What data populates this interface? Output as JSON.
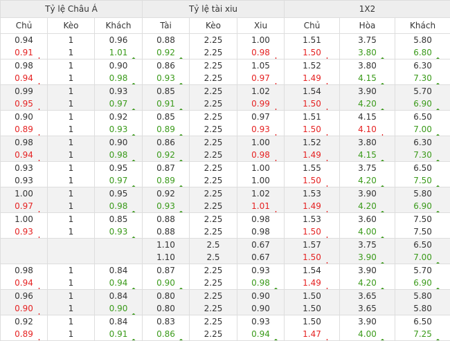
{
  "groups": [
    {
      "label": "Tỷ lệ Châu Á",
      "span": 3
    },
    {
      "label": "Tỷ lệ tài xiu",
      "span": 3
    },
    {
      "label": "1X2",
      "span": 3
    }
  ],
  "columns": [
    "Chủ",
    "Kèo",
    "Khách",
    "Tài",
    "Kèo",
    "Xiu",
    "Chủ",
    "Hòa",
    "Khách"
  ],
  "arrows": {
    "up": "↑",
    "down": "↓"
  },
  "colors": {
    "up": "#3a9a1a",
    "down": "#e52222",
    "neutral": "#333333",
    "header_bg": "#eeeeee",
    "row_alt": "#f2f2f2"
  },
  "rows": [
    {
      "shade": false,
      "cells": [
        [
          {
            "v": "0.94",
            "d": ""
          },
          {
            "v": "0.91",
            "d": "down"
          }
        ],
        [
          {
            "v": "1",
            "d": ""
          },
          {
            "v": "1",
            "d": ""
          }
        ],
        [
          {
            "v": "0.96",
            "d": ""
          },
          {
            "v": "1.01",
            "d": "up"
          }
        ],
        [
          {
            "v": "0.88",
            "d": ""
          },
          {
            "v": "0.92",
            "d": "up"
          }
        ],
        [
          {
            "v": "2.25",
            "d": ""
          },
          {
            "v": "2.25",
            "d": ""
          }
        ],
        [
          {
            "v": "1.00",
            "d": ""
          },
          {
            "v": "0.98",
            "d": "down"
          }
        ],
        [
          {
            "v": "1.51",
            "d": ""
          },
          {
            "v": "1.50",
            "d": "down"
          }
        ],
        [
          {
            "v": "3.75",
            "d": ""
          },
          {
            "v": "3.80",
            "d": "up"
          }
        ],
        [
          {
            "v": "5.80",
            "d": ""
          },
          {
            "v": "6.80",
            "d": "up"
          }
        ]
      ]
    },
    {
      "shade": false,
      "cells": [
        [
          {
            "v": "0.98",
            "d": ""
          },
          {
            "v": "0.94",
            "d": "down"
          }
        ],
        [
          {
            "v": "1",
            "d": ""
          },
          {
            "v": "1",
            "d": ""
          }
        ],
        [
          {
            "v": "0.90",
            "d": ""
          },
          {
            "v": "0.98",
            "d": "up"
          }
        ],
        [
          {
            "v": "0.86",
            "d": ""
          },
          {
            "v": "0.93",
            "d": "up"
          }
        ],
        [
          {
            "v": "2.25",
            "d": ""
          },
          {
            "v": "2.25",
            "d": ""
          }
        ],
        [
          {
            "v": "1.05",
            "d": ""
          },
          {
            "v": "0.97",
            "d": "down"
          }
        ],
        [
          {
            "v": "1.52",
            "d": ""
          },
          {
            "v": "1.49",
            "d": "down"
          }
        ],
        [
          {
            "v": "3.80",
            "d": ""
          },
          {
            "v": "4.15",
            "d": "up"
          }
        ],
        [
          {
            "v": "6.30",
            "d": ""
          },
          {
            "v": "7.30",
            "d": "up"
          }
        ]
      ]
    },
    {
      "shade": true,
      "cells": [
        [
          {
            "v": "0.99",
            "d": ""
          },
          {
            "v": "0.95",
            "d": "down"
          }
        ],
        [
          {
            "v": "1",
            "d": ""
          },
          {
            "v": "1",
            "d": ""
          }
        ],
        [
          {
            "v": "0.93",
            "d": ""
          },
          {
            "v": "0.97",
            "d": "up"
          }
        ],
        [
          {
            "v": "0.85",
            "d": ""
          },
          {
            "v": "0.91",
            "d": "up"
          }
        ],
        [
          {
            "v": "2.25",
            "d": ""
          },
          {
            "v": "2.25",
            "d": ""
          }
        ],
        [
          {
            "v": "1.02",
            "d": ""
          },
          {
            "v": "0.99",
            "d": "down"
          }
        ],
        [
          {
            "v": "1.54",
            "d": ""
          },
          {
            "v": "1.50",
            "d": "down"
          }
        ],
        [
          {
            "v": "3.90",
            "d": ""
          },
          {
            "v": "4.20",
            "d": "up"
          }
        ],
        [
          {
            "v": "5.70",
            "d": ""
          },
          {
            "v": "6.90",
            "d": "up"
          }
        ]
      ]
    },
    {
      "shade": false,
      "cells": [
        [
          {
            "v": "0.90",
            "d": ""
          },
          {
            "v": "0.89",
            "d": "down"
          }
        ],
        [
          {
            "v": "1",
            "d": ""
          },
          {
            "v": "1",
            "d": ""
          }
        ],
        [
          {
            "v": "0.92",
            "d": ""
          },
          {
            "v": "0.93",
            "d": "up"
          }
        ],
        [
          {
            "v": "0.85",
            "d": ""
          },
          {
            "v": "0.89",
            "d": "up"
          }
        ],
        [
          {
            "v": "2.25",
            "d": ""
          },
          {
            "v": "2.25",
            "d": ""
          }
        ],
        [
          {
            "v": "0.97",
            "d": ""
          },
          {
            "v": "0.93",
            "d": "down"
          }
        ],
        [
          {
            "v": "1.51",
            "d": ""
          },
          {
            "v": "1.50",
            "d": "down"
          }
        ],
        [
          {
            "v": "4.15",
            "d": ""
          },
          {
            "v": "4.10",
            "d": "down"
          }
        ],
        [
          {
            "v": "6.50",
            "d": ""
          },
          {
            "v": "7.00",
            "d": "up"
          }
        ]
      ]
    },
    {
      "shade": true,
      "cells": [
        [
          {
            "v": "0.98",
            "d": ""
          },
          {
            "v": "0.94",
            "d": "down"
          }
        ],
        [
          {
            "v": "1",
            "d": ""
          },
          {
            "v": "1",
            "d": ""
          }
        ],
        [
          {
            "v": "0.90",
            "d": ""
          },
          {
            "v": "0.98",
            "d": "up"
          }
        ],
        [
          {
            "v": "0.86",
            "d": ""
          },
          {
            "v": "0.92",
            "d": "up"
          }
        ],
        [
          {
            "v": "2.25",
            "d": ""
          },
          {
            "v": "2.25",
            "d": ""
          }
        ],
        [
          {
            "v": "1.00",
            "d": ""
          },
          {
            "v": "0.98",
            "d": "down"
          }
        ],
        [
          {
            "v": "1.52",
            "d": ""
          },
          {
            "v": "1.49",
            "d": "down"
          }
        ],
        [
          {
            "v": "3.80",
            "d": ""
          },
          {
            "v": "4.15",
            "d": "up"
          }
        ],
        [
          {
            "v": "6.30",
            "d": ""
          },
          {
            "v": "7.30",
            "d": "up"
          }
        ]
      ]
    },
    {
      "shade": false,
      "cells": [
        [
          {
            "v": "0.93",
            "d": ""
          },
          {
            "v": "0.93",
            "d": ""
          }
        ],
        [
          {
            "v": "1",
            "d": ""
          },
          {
            "v": "1",
            "d": ""
          }
        ],
        [
          {
            "v": "0.95",
            "d": ""
          },
          {
            "v": "0.97",
            "d": "up"
          }
        ],
        [
          {
            "v": "0.87",
            "d": ""
          },
          {
            "v": "0.89",
            "d": "up"
          }
        ],
        [
          {
            "v": "2.25",
            "d": ""
          },
          {
            "v": "2.25",
            "d": ""
          }
        ],
        [
          {
            "v": "1.00",
            "d": ""
          },
          {
            "v": "1.00",
            "d": ""
          }
        ],
        [
          {
            "v": "1.55",
            "d": ""
          },
          {
            "v": "1.50",
            "d": "down"
          }
        ],
        [
          {
            "v": "3.75",
            "d": ""
          },
          {
            "v": "4.20",
            "d": "up"
          }
        ],
        [
          {
            "v": "6.50",
            "d": ""
          },
          {
            "v": "7.50",
            "d": "up"
          }
        ]
      ]
    },
    {
      "shade": true,
      "cells": [
        [
          {
            "v": "1.00",
            "d": ""
          },
          {
            "v": "0.97",
            "d": "down"
          }
        ],
        [
          {
            "v": "1",
            "d": ""
          },
          {
            "v": "1",
            "d": ""
          }
        ],
        [
          {
            "v": "0.95",
            "d": ""
          },
          {
            "v": "0.98",
            "d": "up"
          }
        ],
        [
          {
            "v": "0.92",
            "d": ""
          },
          {
            "v": "0.93",
            "d": "up"
          }
        ],
        [
          {
            "v": "2.25",
            "d": ""
          },
          {
            "v": "2.25",
            "d": ""
          }
        ],
        [
          {
            "v": "1.02",
            "d": ""
          },
          {
            "v": "1.01",
            "d": "down"
          }
        ],
        [
          {
            "v": "1.53",
            "d": ""
          },
          {
            "v": "1.49",
            "d": "down"
          }
        ],
        [
          {
            "v": "3.90",
            "d": ""
          },
          {
            "v": "4.20",
            "d": "up"
          }
        ],
        [
          {
            "v": "5.80",
            "d": ""
          },
          {
            "v": "6.90",
            "d": "up"
          }
        ]
      ]
    },
    {
      "shade": false,
      "cells": [
        [
          {
            "v": "1.00",
            "d": ""
          },
          {
            "v": "0.93",
            "d": "down"
          }
        ],
        [
          {
            "v": "1",
            "d": ""
          },
          {
            "v": "1",
            "d": ""
          }
        ],
        [
          {
            "v": "0.85",
            "d": ""
          },
          {
            "v": "0.93",
            "d": "up"
          }
        ],
        [
          {
            "v": "0.88",
            "d": ""
          },
          {
            "v": "0.88",
            "d": ""
          }
        ],
        [
          {
            "v": "2.25",
            "d": ""
          },
          {
            "v": "2.25",
            "d": ""
          }
        ],
        [
          {
            "v": "0.98",
            "d": ""
          },
          {
            "v": "0.98",
            "d": ""
          }
        ],
        [
          {
            "v": "1.53",
            "d": ""
          },
          {
            "v": "1.50",
            "d": "down"
          }
        ],
        [
          {
            "v": "3.60",
            "d": ""
          },
          {
            "v": "4.00",
            "d": "up"
          }
        ],
        [
          {
            "v": "7.50",
            "d": ""
          },
          {
            "v": "7.50",
            "d": ""
          }
        ]
      ]
    },
    {
      "shade": true,
      "cells": [
        [],
        [],
        [],
        [
          {
            "v": "1.10",
            "d": ""
          },
          {
            "v": "1.10",
            "d": ""
          }
        ],
        [
          {
            "v": "2.5",
            "d": ""
          },
          {
            "v": "2.5",
            "d": ""
          }
        ],
        [
          {
            "v": "0.67",
            "d": ""
          },
          {
            "v": "0.67",
            "d": ""
          }
        ],
        [
          {
            "v": "1.57",
            "d": ""
          },
          {
            "v": "1.50",
            "d": "down"
          }
        ],
        [
          {
            "v": "3.75",
            "d": ""
          },
          {
            "v": "3.90",
            "d": "up"
          }
        ],
        [
          {
            "v": "6.50",
            "d": ""
          },
          {
            "v": "7.00",
            "d": "up"
          }
        ]
      ]
    },
    {
      "shade": false,
      "cells": [
        [
          {
            "v": "0.98",
            "d": ""
          },
          {
            "v": "0.94",
            "d": "down"
          }
        ],
        [
          {
            "v": "1",
            "d": ""
          },
          {
            "v": "1",
            "d": ""
          }
        ],
        [
          {
            "v": "0.84",
            "d": ""
          },
          {
            "v": "0.94",
            "d": "up"
          }
        ],
        [
          {
            "v": "0.87",
            "d": ""
          },
          {
            "v": "0.90",
            "d": "up"
          }
        ],
        [
          {
            "v": "2.25",
            "d": ""
          },
          {
            "v": "2.25",
            "d": ""
          }
        ],
        [
          {
            "v": "0.93",
            "d": ""
          },
          {
            "v": "0.98",
            "d": "up"
          }
        ],
        [
          {
            "v": "1.54",
            "d": ""
          },
          {
            "v": "1.49",
            "d": "down"
          }
        ],
        [
          {
            "v": "3.90",
            "d": ""
          },
          {
            "v": "4.20",
            "d": "up"
          }
        ],
        [
          {
            "v": "5.70",
            "d": ""
          },
          {
            "v": "6.90",
            "d": "up"
          }
        ]
      ]
    },
    {
      "shade": true,
      "cells": [
        [
          {
            "v": "0.96",
            "d": ""
          },
          {
            "v": "0.90",
            "d": "down"
          }
        ],
        [
          {
            "v": "1",
            "d": ""
          },
          {
            "v": "1",
            "d": ""
          }
        ],
        [
          {
            "v": "0.84",
            "d": ""
          },
          {
            "v": "0.90",
            "d": "up"
          }
        ],
        [
          {
            "v": "0.80",
            "d": ""
          },
          {
            "v": "0.80",
            "d": ""
          }
        ],
        [
          {
            "v": "2.25",
            "d": ""
          },
          {
            "v": "2.25",
            "d": ""
          }
        ],
        [
          {
            "v": "0.90",
            "d": ""
          },
          {
            "v": "0.90",
            "d": ""
          }
        ],
        [
          {
            "v": "1.50",
            "d": ""
          },
          {
            "v": "1.50",
            "d": ""
          }
        ],
        [
          {
            "v": "3.65",
            "d": ""
          },
          {
            "v": "3.65",
            "d": ""
          }
        ],
        [
          {
            "v": "5.80",
            "d": ""
          },
          {
            "v": "5.80",
            "d": ""
          }
        ]
      ]
    },
    {
      "shade": false,
      "cells": [
        [
          {
            "v": "0.92",
            "d": ""
          },
          {
            "v": "0.89",
            "d": "down"
          }
        ],
        [
          {
            "v": "1",
            "d": ""
          },
          {
            "v": "1",
            "d": ""
          }
        ],
        [
          {
            "v": "0.84",
            "d": ""
          },
          {
            "v": "0.91",
            "d": "up"
          }
        ],
        [
          {
            "v": "0.83",
            "d": ""
          },
          {
            "v": "0.86",
            "d": "up"
          }
        ],
        [
          {
            "v": "2.25",
            "d": ""
          },
          {
            "v": "2.25",
            "d": ""
          }
        ],
        [
          {
            "v": "0.93",
            "d": ""
          },
          {
            "v": "0.94",
            "d": "up"
          }
        ],
        [
          {
            "v": "1.50",
            "d": ""
          },
          {
            "v": "1.47",
            "d": "down"
          }
        ],
        [
          {
            "v": "3.90",
            "d": ""
          },
          {
            "v": "4.00",
            "d": "up"
          }
        ],
        [
          {
            "v": "6.50",
            "d": ""
          },
          {
            "v": "7.25",
            "d": "up"
          }
        ]
      ]
    }
  ]
}
